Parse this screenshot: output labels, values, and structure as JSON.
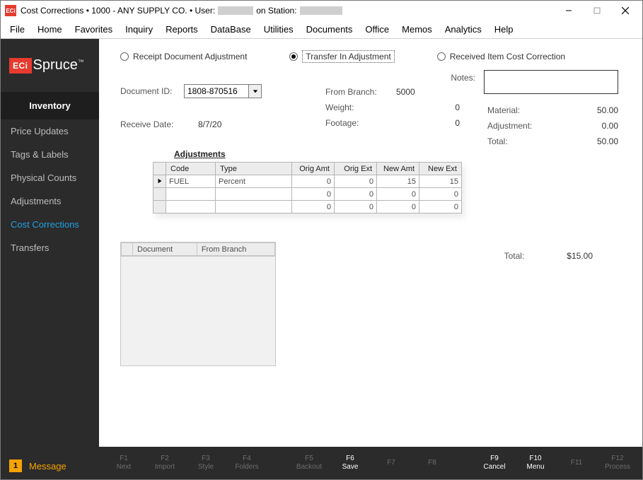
{
  "window": {
    "app_badge": "ECi",
    "title_prefix": "Cost Corrections  •  1000 - ANY SUPPLY CO.  •  User:",
    "title_mid": "on Station:"
  },
  "menubar": [
    "File",
    "Home",
    "Favorites",
    "Inquiry",
    "Reports",
    "DataBase",
    "Utilities",
    "Documents",
    "Office",
    "Memos",
    "Analytics",
    "Help"
  ],
  "sidebar": {
    "logo_sq": "ECi",
    "logo_txt": "Spruce",
    "logo_tm": "™",
    "section": "Inventory",
    "items": [
      "Price Updates",
      "Tags & Labels",
      "Physical Counts",
      "Adjustments",
      "Cost Corrections",
      "Transfers"
    ],
    "active_index": 4,
    "message_count": "1",
    "message_label": "Message"
  },
  "radios": {
    "receipt": "Receipt Document Adjustment",
    "transfer": "Transfer In Adjustment",
    "received_item": "Received Item Cost Correction",
    "selected": "transfer"
  },
  "form": {
    "document_id_label": "Document ID:",
    "document_id_value": "1808-870516",
    "receive_date_label": "Receive Date:",
    "receive_date_value": "8/7/20",
    "from_branch_label": "From Branch:",
    "from_branch_value": "5000",
    "weight_label": "Weight:",
    "weight_value": "0",
    "footage_label": "Footage:",
    "footage_value": "0",
    "notes_label": "Notes:",
    "notes_value": ""
  },
  "summary": {
    "material_label": "Material:",
    "material_value": "50.00",
    "adjustment_label": "Adjustment:",
    "adjustment_value": "0.00",
    "total_label": "Total:",
    "total_value": "50.00"
  },
  "adjustments": {
    "heading": "Adjustments",
    "columns": [
      "Code",
      "Type",
      "Orig Amt",
      "Orig Ext",
      "New Amt",
      "New Ext"
    ],
    "rows": [
      {
        "code": "FUEL",
        "type": "Percent",
        "orig_amt": "0",
        "orig_ext": "0",
        "new_amt": "15",
        "new_ext": "15"
      },
      {
        "code": "",
        "type": "",
        "orig_amt": "0",
        "orig_ext": "0",
        "new_amt": "0",
        "new_ext": "0"
      },
      {
        "code": "",
        "type": "",
        "orig_amt": "0",
        "orig_ext": "0",
        "new_amt": "0",
        "new_ext": "0"
      }
    ]
  },
  "grand_total": {
    "label": "Total:",
    "value": "$15.00"
  },
  "mini_grid": {
    "columns": [
      "Document",
      "From Branch"
    ]
  },
  "fnkeys": [
    {
      "k": "F1",
      "t": "Next",
      "active": false
    },
    {
      "k": "F2",
      "t": "Import",
      "active": false
    },
    {
      "k": "F3",
      "t": "Style",
      "active": false
    },
    {
      "k": "F4",
      "t": "Folders",
      "active": false
    },
    {
      "gap": true
    },
    {
      "k": "F5",
      "t": "Backout",
      "active": false
    },
    {
      "k": "F6",
      "t": "Save",
      "active": true
    },
    {
      "k": "F7",
      "t": "",
      "active": false
    },
    {
      "k": "F8",
      "t": "",
      "active": false
    },
    {
      "gap": true
    },
    {
      "k": "F9",
      "t": "Cancel",
      "active": true
    },
    {
      "k": "F10",
      "t": "Menu",
      "active": true
    },
    {
      "k": "F11",
      "t": "",
      "active": false
    },
    {
      "k": "F12",
      "t": "Process",
      "active": false
    }
  ]
}
